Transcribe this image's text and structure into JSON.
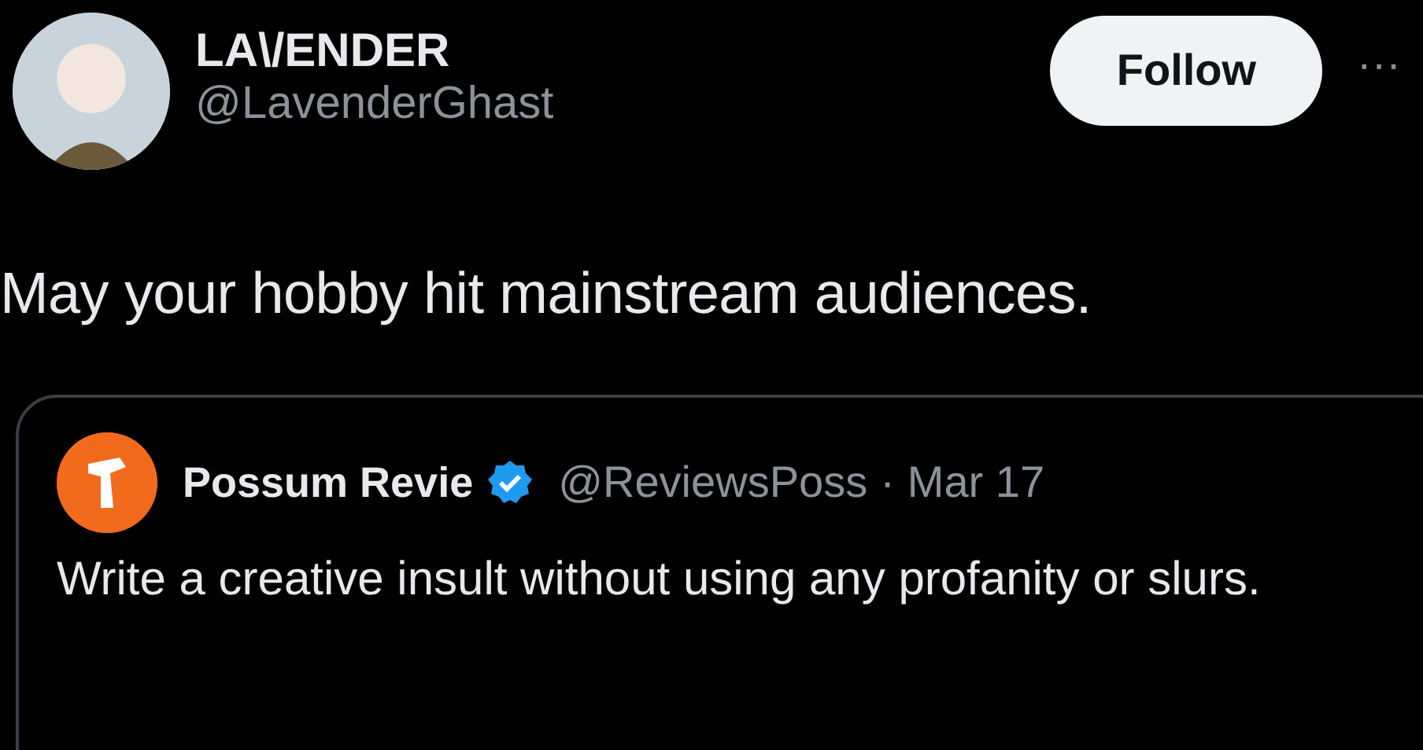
{
  "author": {
    "name": "LA\\/ENDER",
    "handle": "@LavenderGhast"
  },
  "follow_button": "Follow",
  "more": "···",
  "tweet_text": "May your hobby hit mainstream audiences.",
  "quoted": {
    "name": "Possum Revie",
    "handle": "@ReviewsPoss",
    "separator": "·",
    "date": "Mar 17",
    "text": "Write a creative insult without using any profanity or slurs."
  }
}
